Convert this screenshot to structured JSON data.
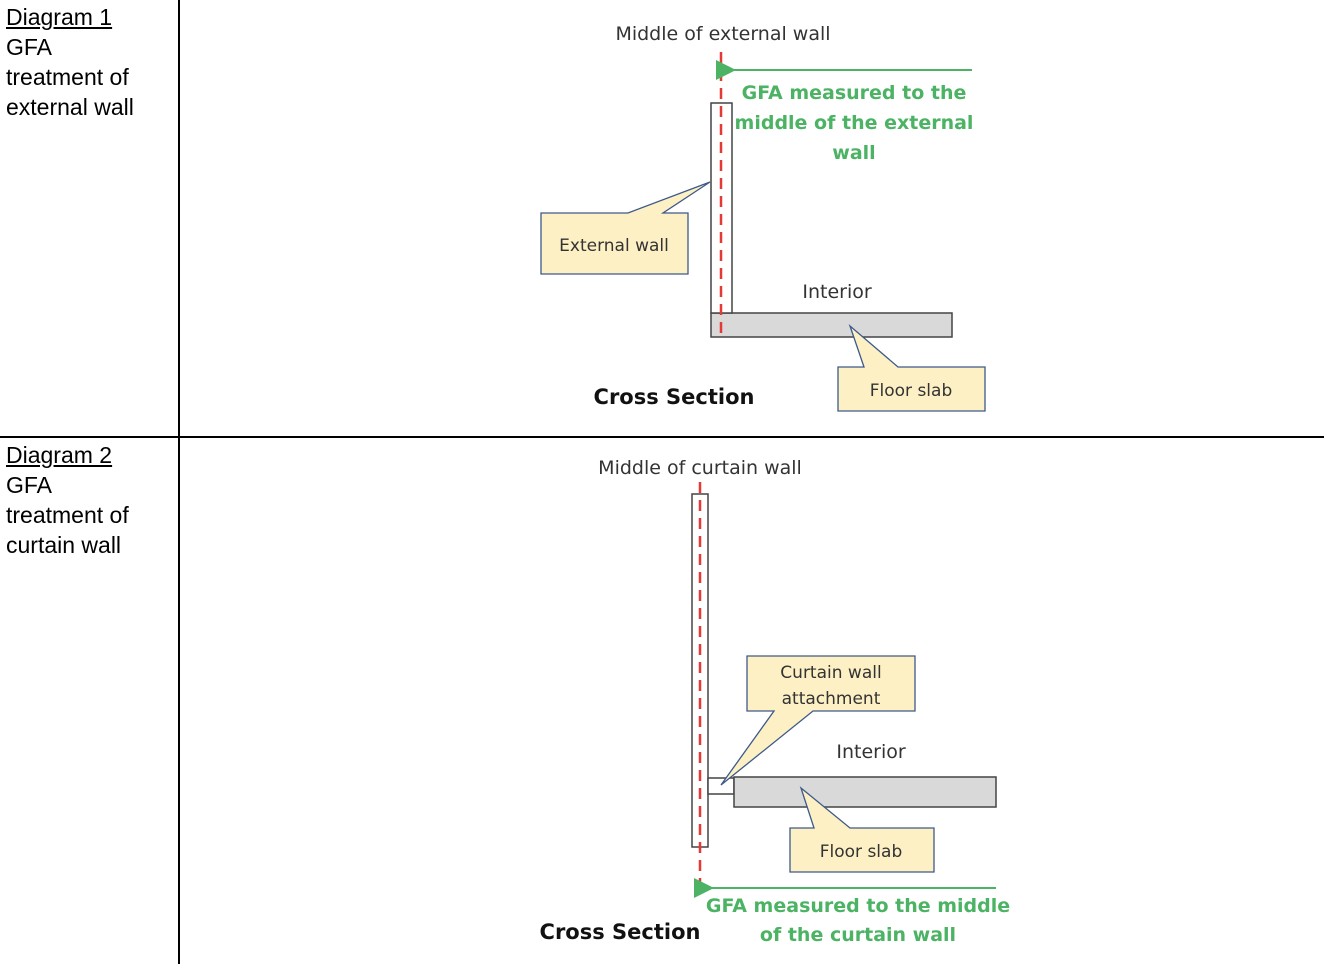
{
  "rows": [
    {
      "title": "Diagram 1",
      "lines": [
        "GFA",
        "treatment of",
        "external wall"
      ],
      "diagram": {
        "top_label": "Middle of external wall",
        "gfa_note": [
          "GFA measured to the",
          "middle of the external",
          "wall"
        ],
        "callouts": {
          "wall": "External wall",
          "slab": "Floor slab"
        },
        "interior_label": "Interior",
        "section_label": "Cross Section"
      }
    },
    {
      "title": "Diagram 2",
      "lines": [
        "GFA",
        "treatment of",
        "curtain wall"
      ],
      "diagram": {
        "top_label": "Middle of curtain wall",
        "gfa_note": [
          "GFA measured to the middle",
          "of the curtain wall"
        ],
        "callouts": {
          "attachment": [
            "Curtain wall",
            "attachment"
          ],
          "slab": "Floor slab"
        },
        "interior_label": "Interior",
        "section_label": "Cross Section"
      }
    }
  ],
  "colors": {
    "midline": "#e53935",
    "gfa": "#4bb363",
    "callout_fill": "#fdf0c4",
    "callout_border": "#3d5a8a",
    "slab_fill": "#d9d9d9",
    "outline": "#444444"
  }
}
